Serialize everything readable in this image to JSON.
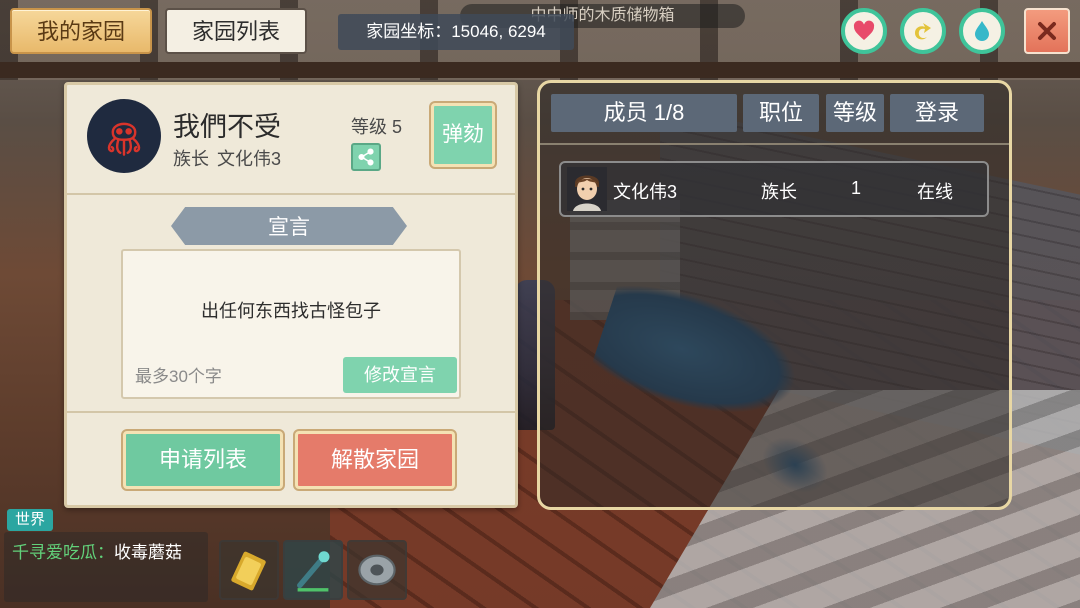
{
  "world": {
    "nearby_object_label": "中中师的木质储物箱"
  },
  "tabs": [
    {
      "label": "我的家园",
      "active": true
    },
    {
      "label": "家园列表",
      "active": false
    }
  ],
  "coordinates": {
    "text": "家园坐标：15046, 6294"
  },
  "status_buttons": [
    {
      "icon": "heart-icon",
      "color": "#e84a6a"
    },
    {
      "icon": "stamina-icon",
      "color": "#e3c33a"
    },
    {
      "icon": "water-drop-icon",
      "color": "#36b8c9"
    }
  ],
  "close_icon": "close-icon",
  "family": {
    "name": "我們不受",
    "leader_title": "族长",
    "leader_name": "文化伟3",
    "level_text": "等级 5",
    "impeach_label": "弹劾",
    "emblem_icon": "octopus-icon",
    "declaration_title": "宣言",
    "declaration_text": "出任何东西找古怪包子",
    "declaration_hint": "最多30个字",
    "edit_declaration_label": "修改宣言",
    "apply_list_label": "申请列表",
    "disband_label": "解散家园"
  },
  "members_panel": {
    "headers": {
      "members": "成员 1/8",
      "position": "职位",
      "level": "等级",
      "login": "登录"
    },
    "rows": [
      {
        "name": "文化伟3",
        "position": "族长",
        "level": "1",
        "status": "在线"
      }
    ]
  },
  "chat": {
    "channel": "世界",
    "user": "千寻爱吃瓜",
    "separator": "：",
    "message": "收毒蘑菇"
  },
  "hotbar": [
    {
      "icon": "gold-bar-icon",
      "selected": false
    },
    {
      "icon": "staff-icon",
      "selected": true
    },
    {
      "icon": "shield-disc-icon",
      "selected": false
    }
  ],
  "colors": {
    "accent_green": "#7fd3ae",
    "danger_red": "#e57b6a",
    "tab_gold": "#e8b96b",
    "panel_header": "#5c6877"
  }
}
